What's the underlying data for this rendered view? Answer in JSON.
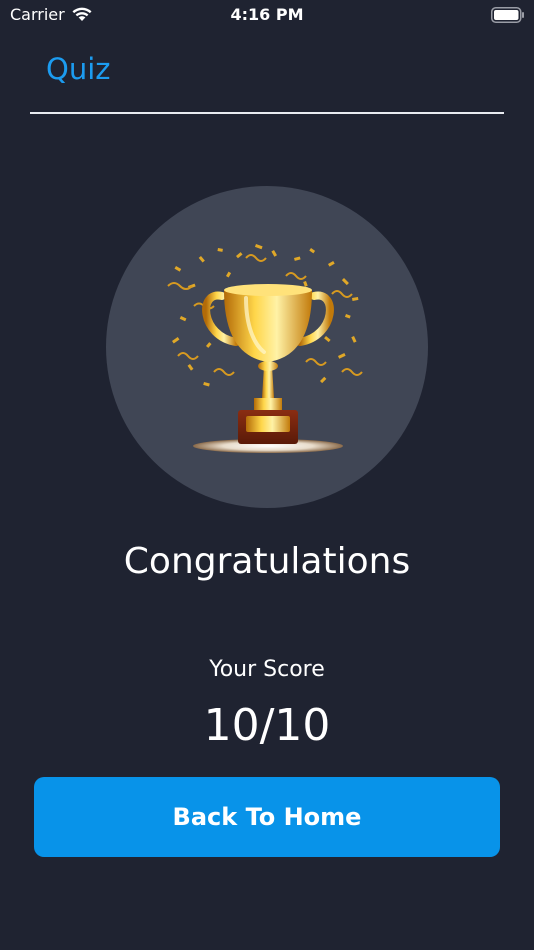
{
  "status_bar": {
    "carrier": "Carrier",
    "time": "4:16 PM",
    "wifi_icon": "wifi-icon",
    "battery_icon": "battery-icon"
  },
  "header": {
    "title": "Quiz"
  },
  "result": {
    "image_icon": "trophy-icon",
    "heading": "Congratulations",
    "score_label": "Your Score",
    "score_value": "10/10"
  },
  "actions": {
    "home_button_label": "Back To Home"
  },
  "colors": {
    "background": "#1f2331",
    "accent": "#1c9cf0",
    "button": "#0893e9",
    "circle": "#404655"
  }
}
